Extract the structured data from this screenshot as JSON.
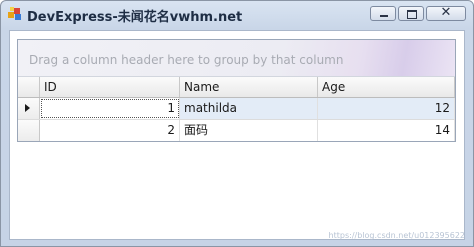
{
  "window": {
    "title": "DevExpress-未闻花名vwhm.net",
    "icon": "devexpress-app-icon",
    "controls": {
      "minimize": "minimize-icon",
      "maximize": "maximize-icon",
      "close_glyph": "✕"
    }
  },
  "grid": {
    "group_panel_text": "Drag a column header here to group by that column",
    "columns": [
      {
        "label": "ID"
      },
      {
        "label": "Name"
      },
      {
        "label": "Age"
      }
    ],
    "rows": [
      {
        "id": "1",
        "name": "mathilda",
        "age": "12",
        "selected": true
      },
      {
        "id": "2",
        "name": "面码",
        "age": "14",
        "selected": false
      }
    ]
  },
  "watermark": "https://blog.csdn.net/u012395622",
  "colors": {
    "window_frame": "#c9d6e8",
    "title_text": "#1e2d44",
    "selected_row": "#e3ecf7",
    "group_panel_text": "#a8abb3"
  }
}
